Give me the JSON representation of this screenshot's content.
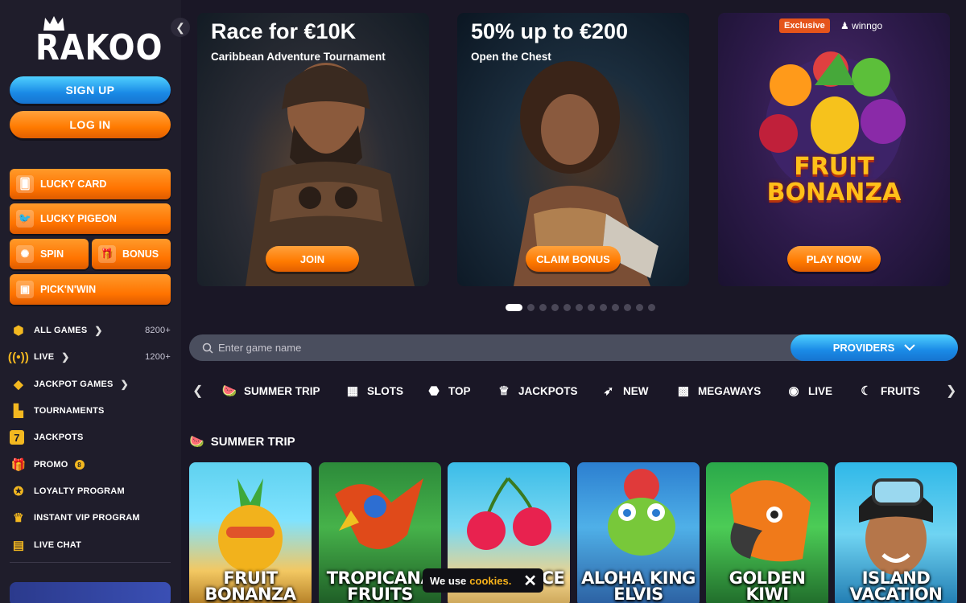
{
  "brand": {
    "logo": "RAKOO"
  },
  "auth": {
    "signup": "SIGN UP",
    "login": "LOG IN"
  },
  "promo_buttons": {
    "lucky_card": "LUCKY CARD",
    "lucky_pigeon": "LUCKY PIGEON",
    "spin": "SPIN",
    "bonus": "BONUS",
    "picknwin": "PICK'N'WIN"
  },
  "nav": [
    {
      "label": "ALL GAMES",
      "count": "8200+",
      "icon": "cube-icon"
    },
    {
      "label": "LIVE",
      "count": "1200+",
      "icon": "broadcast-icon"
    },
    {
      "label": "JACKPOT GAMES",
      "icon": "diamond-icon"
    },
    {
      "label": "TOURNAMENTS",
      "icon": "podium-icon"
    },
    {
      "label": "JACKPOTS",
      "icon": "seven-icon"
    },
    {
      "label": "PROMO",
      "badge": "8",
      "icon": "gift-icon"
    },
    {
      "label": "LOYALTY PROGRAM",
      "icon": "medal-icon"
    },
    {
      "label": "INSTANT VIP PROGRAM",
      "icon": "vip-icon"
    },
    {
      "label": "LIVE CHAT",
      "icon": "chat-icon"
    }
  ],
  "banners": [
    {
      "title": "Race for €10K",
      "subtitle": "Caribbean Adventure Tournament",
      "cta": "JOIN"
    },
    {
      "title": "50% up to €200",
      "subtitle": "Open the Chest",
      "cta": "CLAIM BONUS"
    },
    {
      "tag": "Exclusive",
      "brand": "winngo",
      "art_text_1": "FRUIT",
      "art_text_2": "BONANZA",
      "cta": "PLAY NOW"
    }
  ],
  "carousel": {
    "count": 12,
    "active": 0
  },
  "search": {
    "placeholder": "Enter game name",
    "value": "",
    "providers": "PROVIDERS"
  },
  "categories": [
    "SUMMER TRIP",
    "SLOTS",
    "TOP",
    "JACKPOTS",
    "NEW",
    "MEGAWAYS",
    "LIVE",
    "FRUITS"
  ],
  "section": {
    "title": "SUMMER TRIP"
  },
  "games": [
    {
      "l1": "FRUIT",
      "l2": "BONANZA"
    },
    {
      "l1": "TROPICANA",
      "l2": "FRUITS"
    },
    {
      "l1": "",
      "l2": "PARTY JUICE"
    },
    {
      "l1": "ALOHA KING",
      "l2": "ELVIS"
    },
    {
      "l1": "GOLDEN",
      "l2": "KIWI"
    },
    {
      "l1": "ISLAND",
      "l2": "VACATION"
    }
  ],
  "cookie": {
    "text": "We use",
    "link": "cookies."
  },
  "colors": {
    "bg": "#1a1726",
    "sidebar": "#1f1d2b",
    "accent_orange": "#ff7a00",
    "accent_blue": "#1a8ae6",
    "gold": "#f3b820"
  }
}
